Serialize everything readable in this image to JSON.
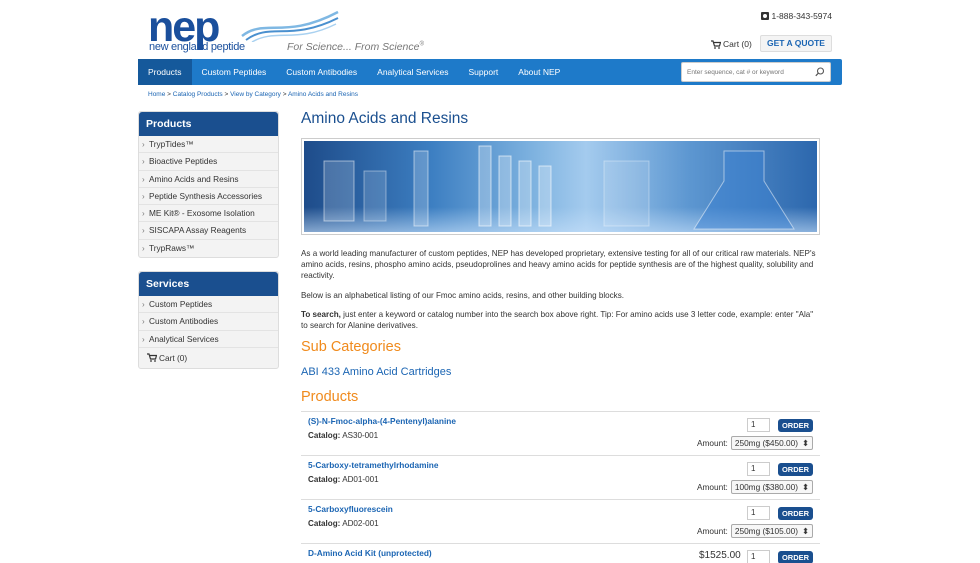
{
  "header": {
    "logo_main": "nep",
    "logo_sub": "new england peptide",
    "tagline": "For Science... From Science",
    "tagline_mark": "®",
    "phone": "1-888-343-5974",
    "cart_label": "Cart (0)",
    "quote_button": "GET A QUOTE"
  },
  "nav": {
    "items": [
      "Products",
      "Custom Peptides",
      "Custom Antibodies",
      "Analytical Services",
      "Support",
      "About NEP"
    ],
    "search_placeholder": "Enter sequence, cat # or keyword"
  },
  "breadcrumb": {
    "items": [
      "Home",
      "Catalog Products",
      "View by Category",
      "Amino Acids and Resins"
    ],
    "separator": ">"
  },
  "sidebar": {
    "products": {
      "title": "Products",
      "items": [
        "TrypTides™",
        "Bioactive Peptides",
        "Amino Acids and Resins",
        "Peptide Synthesis Accessories",
        "ME Kit® - Exosome Isolation",
        "SISCAPA Assay Reagents",
        "TrypRaws™"
      ]
    },
    "services": {
      "title": "Services",
      "items": [
        "Custom Peptides",
        "Custom Antibodies",
        "Analytical Services"
      ],
      "cart": "Cart (0)"
    }
  },
  "main": {
    "title": "Amino Acids and Resins",
    "intro": "As a world leading manufacturer of custom peptides, NEP has developed proprietary, extensive testing for all of our critical raw materials. NEP's amino acids, resins, phospho amino acids, pseudoprolines and heavy amino acids for peptide synthesis are of the highest quality, solubility and reactivity.",
    "listing_note": "Below is an alphabetical listing of our Fmoc amino acids, resins, and other building blocks.",
    "search_tip_bold": "To search,",
    "search_tip": " just enter a keyword or catalog number into the search box above right.  Tip: For amino acids use 3 letter code, example: enter \"Ala\" to search for Alanine derivatives.",
    "sub_categories_title": "Sub Categories",
    "sub_category_link": "ABI 433 Amino Acid Cartridges",
    "products_title": "Products"
  },
  "products": [
    {
      "name": "(S)-N-Fmoc-alpha-(4-Pentenyl)alanine",
      "catalog_label": "Catalog:",
      "catalog": "AS30-001",
      "qty": "1",
      "order": "ORDER",
      "amount_label": "Amount:",
      "amount": "250mg ($450.00)"
    },
    {
      "name": "5-Carboxy-tetramethylrhodamine",
      "catalog_label": "Catalog:",
      "catalog": "AD01-001",
      "qty": "1",
      "order": "ORDER",
      "amount_label": "Amount:",
      "amount": "100mg ($380.00)"
    },
    {
      "name": "5-Carboxyfluorescein",
      "catalog_label": "Catalog:",
      "catalog": "AD02-001",
      "qty": "1",
      "order": "ORDER",
      "amount_label": "Amount:",
      "amount": "250mg ($105.00)"
    },
    {
      "name": "D-Amino Acid Kit (unprotected)",
      "price": "$1525.00",
      "qty": "1",
      "order": "ORDER"
    }
  ],
  "colors": {
    "brand_blue": "#1a4f9c",
    "nav_blue": "#1e7ac9",
    "panel_head": "#1a4f8f",
    "link_blue": "#1b65b3",
    "accent_orange": "#f08a1c"
  }
}
